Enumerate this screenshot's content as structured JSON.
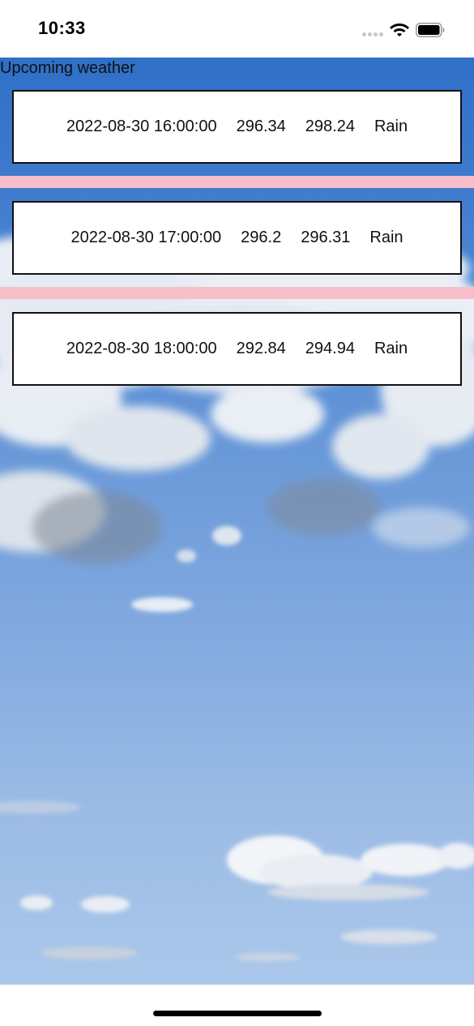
{
  "status_bar": {
    "time": "10:33",
    "icons": [
      "signal-dots-icon",
      "wifi-icon",
      "battery-icon"
    ]
  },
  "header": {
    "label": "Upcoming weather"
  },
  "forecast": [
    {
      "datetime": "2022-08-30 16:00:00",
      "temp": "296.34",
      "feels_like": "298.24",
      "condition": "Rain"
    },
    {
      "datetime": "2022-08-30 17:00:00",
      "temp": "296.2",
      "feels_like": "296.31",
      "condition": "Rain"
    },
    {
      "datetime": "2022-08-30 18:00:00",
      "temp": "292.84",
      "feels_like": "294.94",
      "condition": "Rain"
    }
  ],
  "colors": {
    "separator": "#f8bfcb",
    "sky_top": "#2f6fc6",
    "sky_bottom": "#aac7ea"
  }
}
